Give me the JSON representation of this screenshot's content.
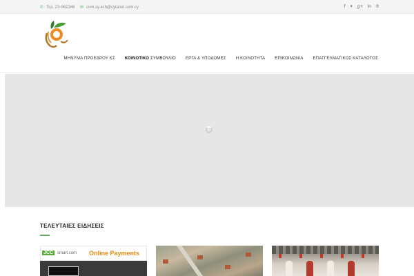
{
  "topbar": {
    "phone_icon": "phone-icon",
    "phone": "Τηλ. 23-962346",
    "email_icon": "envelope-icon",
    "email": "com.sy.ach@cytanet.com.cy",
    "socials": [
      {
        "icon": "facebook-icon",
        "glyph": "f"
      },
      {
        "icon": "twitter-icon",
        "glyph": "✦"
      },
      {
        "icon": "googleplus-icon",
        "glyph": "g+"
      },
      {
        "icon": "linkedin-icon",
        "glyph": "in"
      },
      {
        "icon": "pinterest-icon",
        "glyph": "℗"
      }
    ]
  },
  "nav": {
    "items": [
      {
        "label": "ΜΗΝΥΜΑ ΠΡΟΕΔΡΟΥ ΚΣ"
      },
      {
        "label_bold": "ΚΟΙΝΟΤΙΚΟ",
        "label_rest": " ΣΥΜΒΟΥΛΙΟ"
      },
      {
        "label": "ΕΡΓΑ & ΥΠΟΔΟΜΕΣ"
      },
      {
        "label": "Η ΚΟΙΝΟΤΗΤΑ"
      },
      {
        "label": "ΕΠΙΚΟΙΝΩΝΙΑ"
      },
      {
        "label": "ΕΠΑΓΓΕΛΜΑΤΙΚΟΣ ΚΑΤΑΛΟΓΟΣ"
      }
    ]
  },
  "news": {
    "title": "ΤΕΛΕΥΤΑΙΕΣ ΕΙΔΗΣΕΙΣ",
    "card1": {
      "jcc": "JCC",
      "smart": "smart.com",
      "payments": "Online Payments"
    }
  },
  "colors": {
    "accent": "#67a96b",
    "slider_bg": "#e6e6e6",
    "payments_orange": "#e08b12"
  }
}
